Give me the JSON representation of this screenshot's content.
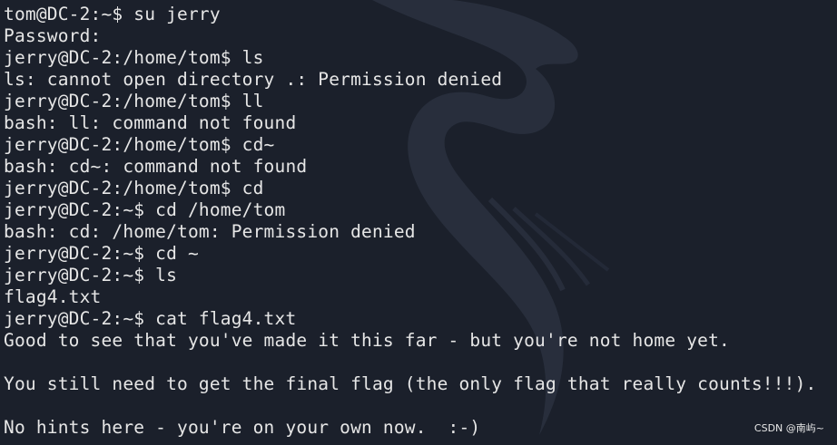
{
  "terminal": {
    "lines": [
      "tom@DC-2:~$ su jerry",
      "Password:",
      "jerry@DC-2:/home/tom$ ls",
      "ls: cannot open directory .: Permission denied",
      "jerry@DC-2:/home/tom$ ll",
      "bash: ll: command not found",
      "jerry@DC-2:/home/tom$ cd~",
      "bash: cd~: command not found",
      "jerry@DC-2:/home/tom$ cd",
      "jerry@DC-2:~$ cd /home/tom",
      "bash: cd: /home/tom: Permission denied",
      "jerry@DC-2:~$ cd ~",
      "jerry@DC-2:~$ ls",
      "flag4.txt",
      "jerry@DC-2:~$ cat flag4.txt",
      "Good to see that you've made it this far - but you're not home yet.",
      "",
      "You still need to get the final flag (the only flag that really counts!!!).",
      "",
      "No hints here - you're on your own now.  :-)"
    ]
  },
  "watermark": {
    "text": "CSDN @南屿~"
  },
  "colors": {
    "background": "#1b202b",
    "text": "#e6e6e6",
    "dragon": "#2a3140"
  }
}
